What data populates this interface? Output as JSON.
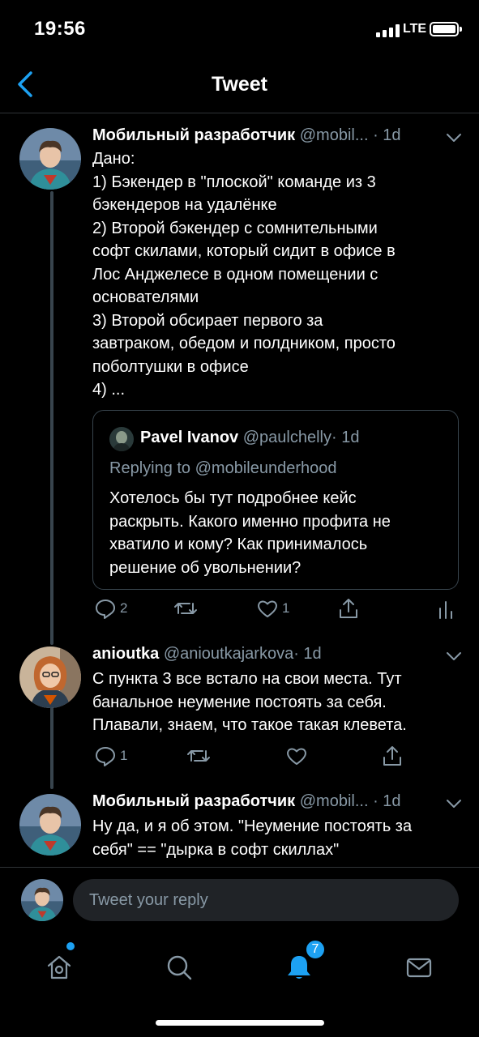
{
  "status": {
    "time": "19:56",
    "network": "LTE"
  },
  "nav": {
    "title": "Tweet"
  },
  "tweets": [
    {
      "author": "Мобильный разработчик",
      "handle": "@mobil...",
      "time": "· 1d",
      "lines": [
        "Дано:",
        "1) Бэкендер в \"плоской\" команде из 3",
        "бэкендеров на удалёнке",
        "2) Второй бэкендер с сомнительными",
        "софт скилами, который сидит в офисе в",
        "Лос Анджелесе в одном помещении с",
        "основателями",
        "3) Второй обсирает первого за",
        "завтраком, обедом и полдником, просто",
        "поболтушки в офисе",
        "4) ..."
      ],
      "quote": {
        "author": "Pavel Ivanov",
        "handle": "@paulchelly",
        "time": "· 1d",
        "replying": "Replying to @mobileunderhood",
        "lines": [
          "Хотелось бы тут подробнее кейс",
          "раскрыть. Какого именно профита не",
          "хватило и кому? Как принималось",
          "решение об увольнении?"
        ]
      },
      "reply_count": "2",
      "like_count": "1"
    },
    {
      "author": "anioutka",
      "handle": "@anioutkajarkova",
      "time": "· 1d",
      "lines": [
        "С пункта 3 все встало на свои места. Тут",
        "банальное неумение постоять за себя.",
        "Плавали, знаем, что такое такая клевета."
      ],
      "reply_count": "1"
    },
    {
      "author": "Мобильный разработчик",
      "handle": "@mobil...",
      "time": "· 1d",
      "lines": [
        "Ну да, и я об этом. \"Неумение постоять за",
        "себя\" == \"дырка в софт скиллах\""
      ]
    }
  ],
  "reply_bar": {
    "placeholder": "Tweet your reply"
  },
  "tabs": {
    "notifications_badge": "7"
  },
  "colors": {
    "accent": "#1da1f2",
    "secondary_text": "#8899a6",
    "divider": "#2f3336"
  }
}
